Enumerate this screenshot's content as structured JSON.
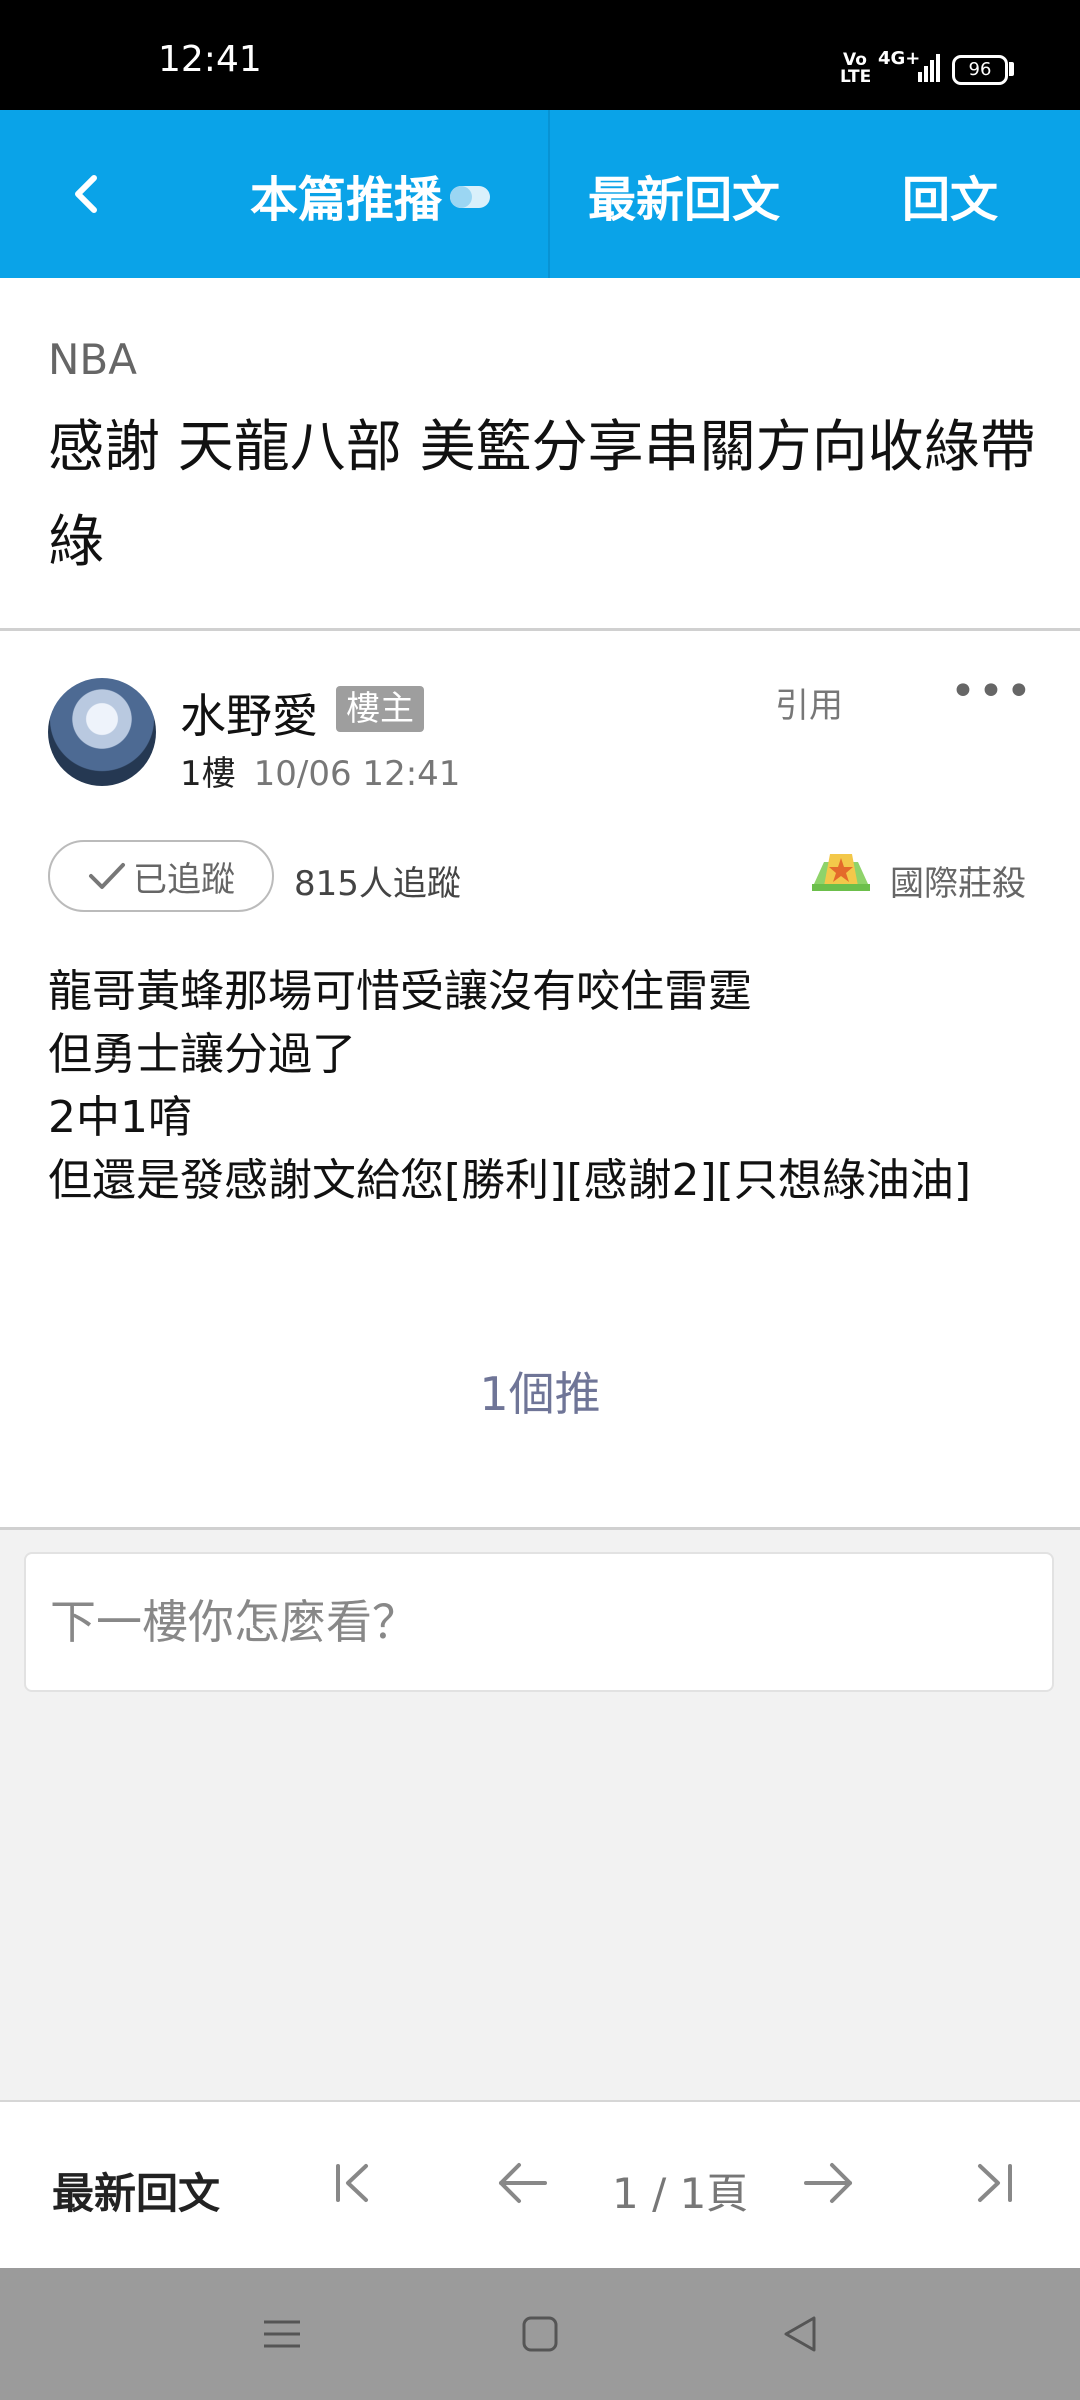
{
  "status_bar": {
    "time": "12:41",
    "volte": "Vo LTE",
    "network": "4G+",
    "battery": "96"
  },
  "header": {
    "back_icon": "chevron-left-icon",
    "push_label": "本篇推播",
    "push_toggle_on": false,
    "latest_reply": "最新回文",
    "reply": "回文"
  },
  "post": {
    "board": "NBA",
    "title": "感謝 天龍八部   美籃分享串關方向收綠帶綠",
    "author": {
      "name": "水野愛",
      "badge": "樓主",
      "floor": "1樓",
      "datetime": "10/06 12:41"
    },
    "quote_label": "引用",
    "more_label": "•••",
    "follow_label": "已追蹤",
    "followers": "815人追蹤",
    "user_badge_label": "國際莊殺",
    "body_lines": [
      "龍哥黃蜂那場可惜受讓沒有咬住雷霆",
      "但勇士讓分過了",
      "2中1唷",
      "但還是發感謝文給您[勝利][感謝2][只想綠油油]"
    ],
    "push_count": "1個推"
  },
  "reply_input": {
    "placeholder": "下一樓你怎麼看？",
    "value": ""
  },
  "pager": {
    "latest_reply": "最新回文",
    "page_indicator": "1 / 1頁"
  },
  "colors": {
    "header_bg": "#0aa3e8",
    "push_count": "#6f7597",
    "op_badge": "#9e9e9e"
  }
}
